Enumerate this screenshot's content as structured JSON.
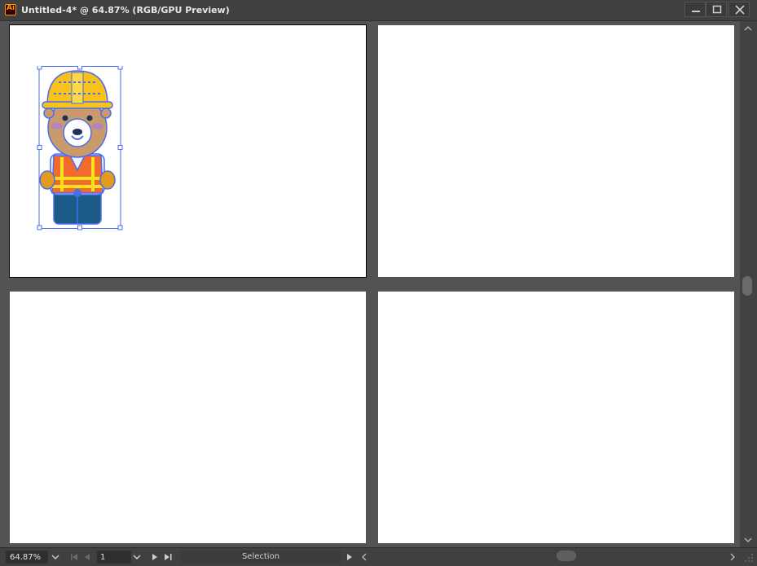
{
  "window": {
    "title": "Untitled-4* @ 64.87% (RGB/GPU Preview)",
    "app_icon_text": "Ai"
  },
  "status": {
    "zoom": "64.87%",
    "page": "1",
    "tool": "Selection"
  },
  "colors": {
    "hardhat": "#f6c21b",
    "skin": "#c99a6b",
    "vest": "#f26b2d",
    "reflective": "#f6e21c",
    "pants": "#1a5c87",
    "selection": "#4a6cf0"
  }
}
